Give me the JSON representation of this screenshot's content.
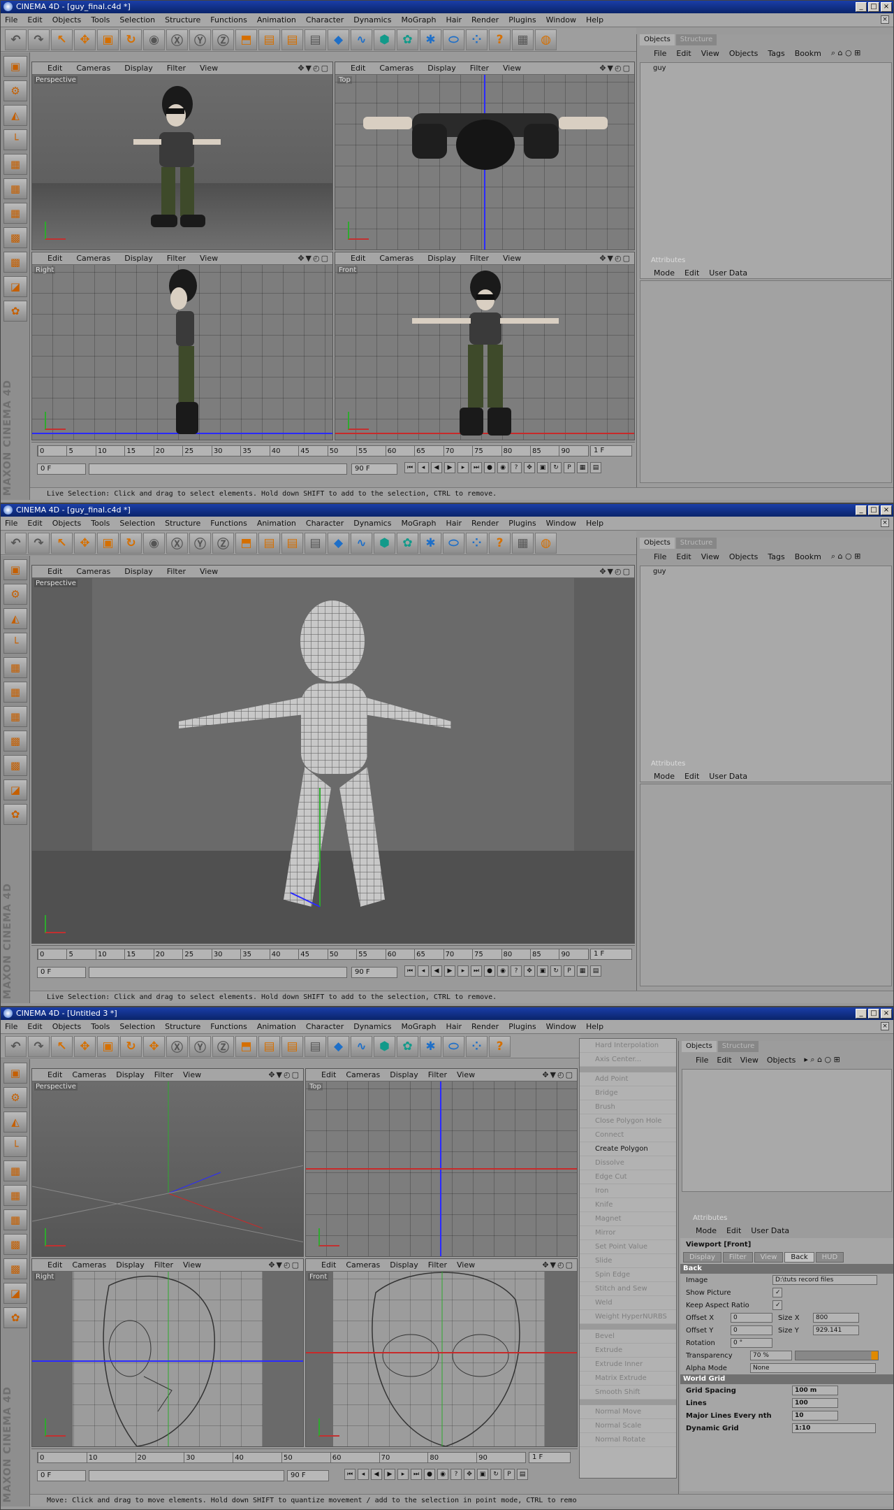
{
  "menu": [
    "File",
    "Edit",
    "Objects",
    "Tools",
    "Selection",
    "Structure",
    "Functions",
    "Animation",
    "Character",
    "Dynamics",
    "MoGraph",
    "Hair",
    "Render",
    "Plugins",
    "Window",
    "Help"
  ],
  "window_buttons": [
    "_",
    "□",
    "×"
  ],
  "vp_menu": [
    "Edit",
    "Cameras",
    "Display",
    "Filter",
    "View"
  ],
  "vp_nav": "✥▼◴▢",
  "panel_tabs": [
    "Objects",
    "Structure"
  ],
  "obj_menu": [
    "File",
    "Edit",
    "View",
    "Objects",
    "Tags",
    "Bookm"
  ],
  "attr_menu": [
    "Mode",
    "Edit",
    "User Data"
  ],
  "attr_title": "Attributes",
  "frame_start": "0 F",
  "frame_end": "90 F",
  "frame_current": "1 F",
  "frame_zero": "0 F",
  "brand": "MAXON CINEMA 4D",
  "ruler1": [
    "0",
    "5",
    "10",
    "15",
    "20",
    "25",
    "30",
    "35",
    "40",
    "45",
    "50",
    "55",
    "60",
    "65",
    "70",
    "75",
    "80",
    "85",
    "90"
  ],
  "ruler3": [
    "0",
    "10",
    "20",
    "30",
    "40",
    "50",
    "60",
    "70",
    "80",
    "90"
  ],
  "windows": [
    {
      "title": "CINEMA 4D - [guy_final.c4d *]",
      "object": "guy",
      "viewports": [
        "Perspective",
        "Top",
        "Right",
        "Front"
      ],
      "status": "Live Selection: Click and drag to select elements. Hold down SHIFT to add to the selection, CTRL to remove."
    },
    {
      "title": "CINEMA 4D - [guy_final.c4d *]",
      "object": "guy",
      "viewports": [
        "Perspective"
      ],
      "status": "Live Selection: Click and drag to select elements. Hold down SHIFT to add to the selection, CTRL to remove."
    },
    {
      "title": "CINEMA 4D - [Untitled 3 *]",
      "object": "",
      "viewports": [
        "Perspective",
        "Top",
        "Right",
        "Front"
      ],
      "status": "Move: Click and drag to move elements. Hold down SHIFT to quantize movement / add to the selection in point mode, CTRL to remo"
    }
  ],
  "context_menu": {
    "group1": [
      "Hard Interpolation",
      "Axis Center..."
    ],
    "group2": [
      "Add Point",
      "Bridge",
      "Brush",
      "Close Polygon Hole",
      "Connect",
      "Create Polygon",
      "Dissolve",
      "Edge Cut",
      "Iron",
      "Knife",
      "Magnet",
      "Mirror",
      "Set Point Value",
      "Slide",
      "Spin Edge",
      "Stitch and Sew",
      "Weld",
      "Weight HyperNURBS"
    ],
    "group3": [
      "Bevel",
      "Extrude",
      "Extrude Inner",
      "Matrix Extrude",
      "Smooth Shift"
    ],
    "group4": [
      "Normal Move",
      "Normal Scale",
      "Normal Rotate"
    ],
    "active": "Create Polygon"
  },
  "viewport_attrs": {
    "title": "Viewport [Front]",
    "tabs": [
      "Display",
      "Filter",
      "View",
      "Back",
      "HUD"
    ],
    "active_tab": "Back",
    "section": "Back",
    "image_label": "Image",
    "image_value": "D:\\tuts record files",
    "show_picture": "Show Picture",
    "keep_aspect": "Keep Aspect Ratio",
    "offset_x_label": "Offset X",
    "offset_x": "0",
    "offset_y_label": "Offset Y",
    "offset_y": "0",
    "size_x_label": "Size X",
    "size_x": "800",
    "size_y_label": "Size Y",
    "size_y": "929.141",
    "rotation_label": "Rotation",
    "rotation": "0 °",
    "transparency_label": "Transparency",
    "transparency": "70 %",
    "alpha_label": "Alpha Mode",
    "alpha": "None",
    "grid_section": "World Grid",
    "grid_spacing_label": "Grid Spacing",
    "grid_spacing": "100 m",
    "lines_label": "Lines",
    "lines": "100",
    "major_label": "Major Lines Every nth",
    "major": "10",
    "dynamic_label": "Dynamic Grid",
    "dynamic": "1:10"
  },
  "obj_menu3": [
    "File",
    "Edit",
    "View",
    "Objects"
  ]
}
